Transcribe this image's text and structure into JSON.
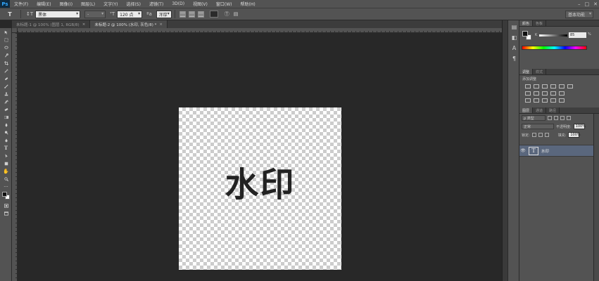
{
  "app": {
    "logo": "Ps"
  },
  "menubar": {
    "items": [
      "文件(F)",
      "编辑(E)",
      "图像(I)",
      "图层(L)",
      "文字(Y)",
      "选择(S)",
      "滤镜(T)",
      "3D(D)",
      "视图(V)",
      "窗口(W)",
      "帮助(H)"
    ],
    "window_controls": {
      "minimize": "–",
      "restore": "□",
      "close": "✕"
    }
  },
  "options": {
    "tool_preset": "T",
    "orientation_icon": "↕T",
    "font_family": "黑体",
    "font_style": "-",
    "size_icon": "ᵀT",
    "font_size": "120 点",
    "aa_label": "ªa",
    "aa_mode": "浑厚",
    "color": "#2b2b2b",
    "warp_icon": "Ⓣ",
    "panel_icon": "▤",
    "workspace": "基本功能"
  },
  "tabs": [
    {
      "label": "未标题-1 @ 100% (图层 1, RGB/8)",
      "close": "×"
    },
    {
      "label": "未标题-2 @ 100% (水印, 灰色/8) *",
      "close": "×"
    }
  ],
  "toolbar": {
    "tools": [
      "move",
      "marquee",
      "lasso",
      "quick-select",
      "crop",
      "eyedropper",
      "healing",
      "brush",
      "clone-stamp",
      "history-brush",
      "eraser",
      "gradient",
      "blur",
      "dodge",
      "pen",
      "type",
      "path-select",
      "shape",
      "hand",
      "zoom"
    ],
    "type_glyph": "T",
    "hand_glyph": "✋",
    "zoom_glyph": "🔍︎"
  },
  "canvas": {
    "watermark_text": "水印"
  },
  "panels": {
    "color_tabs": [
      "颜色",
      "色板"
    ],
    "color_k_label": "K",
    "color_k_value": "85",
    "color_k_unit": "%",
    "adjust_tabs": [
      "调整",
      "样式"
    ],
    "adjust_title": "添加调整",
    "layers_tabs": [
      "图层",
      "通道",
      "路径"
    ],
    "filter_kind": "ρ 类型",
    "blend_mode": "正常",
    "opacity_label": "不透明度:",
    "opacity_value": "100%",
    "lock_label": "锁定:",
    "fill_label": "填充:",
    "fill_value": "100%",
    "layer_name": "水印",
    "layer_thumb": "T"
  }
}
